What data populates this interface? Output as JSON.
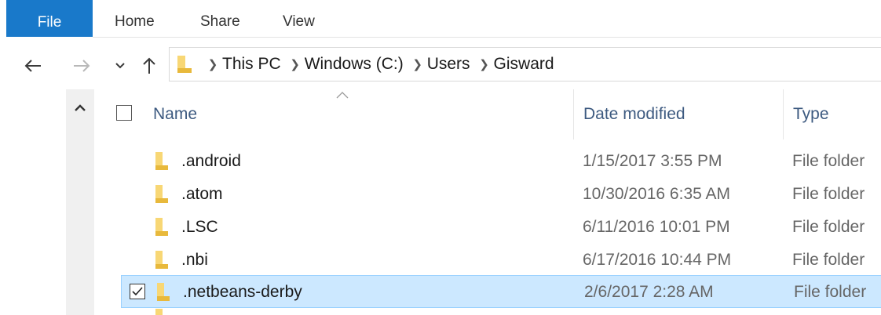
{
  "ribbon": {
    "tabs": [
      "File",
      "Home",
      "Share",
      "View"
    ]
  },
  "nav": {
    "back_icon": "arrow-left-icon",
    "forward_icon": "arrow-right-icon",
    "recent_icon": "chevron-down-icon",
    "up_icon": "arrow-up-icon"
  },
  "address": {
    "crumbs": [
      "This PC",
      "Windows (C:)",
      "Users",
      "Gisward"
    ],
    "folder_color": "#f8d775"
  },
  "columns": {
    "name": "Name",
    "date": "Date modified",
    "type": "Type"
  },
  "files": [
    {
      "name": ".android",
      "date": "1/15/2017 3:55 PM",
      "type": "File folder",
      "selected": false
    },
    {
      "name": ".atom",
      "date": "10/30/2016 6:35 AM",
      "type": "File folder",
      "selected": false
    },
    {
      "name": ".LSC",
      "date": "6/11/2016 10:01 PM",
      "type": "File folder",
      "selected": false
    },
    {
      "name": ".nbi",
      "date": "6/17/2016 10:44 PM",
      "type": "File folder",
      "selected": false
    },
    {
      "name": ".netbeans-derby",
      "date": "2/6/2017 2:28 AM",
      "type": "File folder",
      "selected": true
    }
  ],
  "colors": {
    "file_tab": "#1979ca",
    "selection": "#cce8ff",
    "selection_border": "#99d1ff",
    "folder": "#f8d775"
  }
}
